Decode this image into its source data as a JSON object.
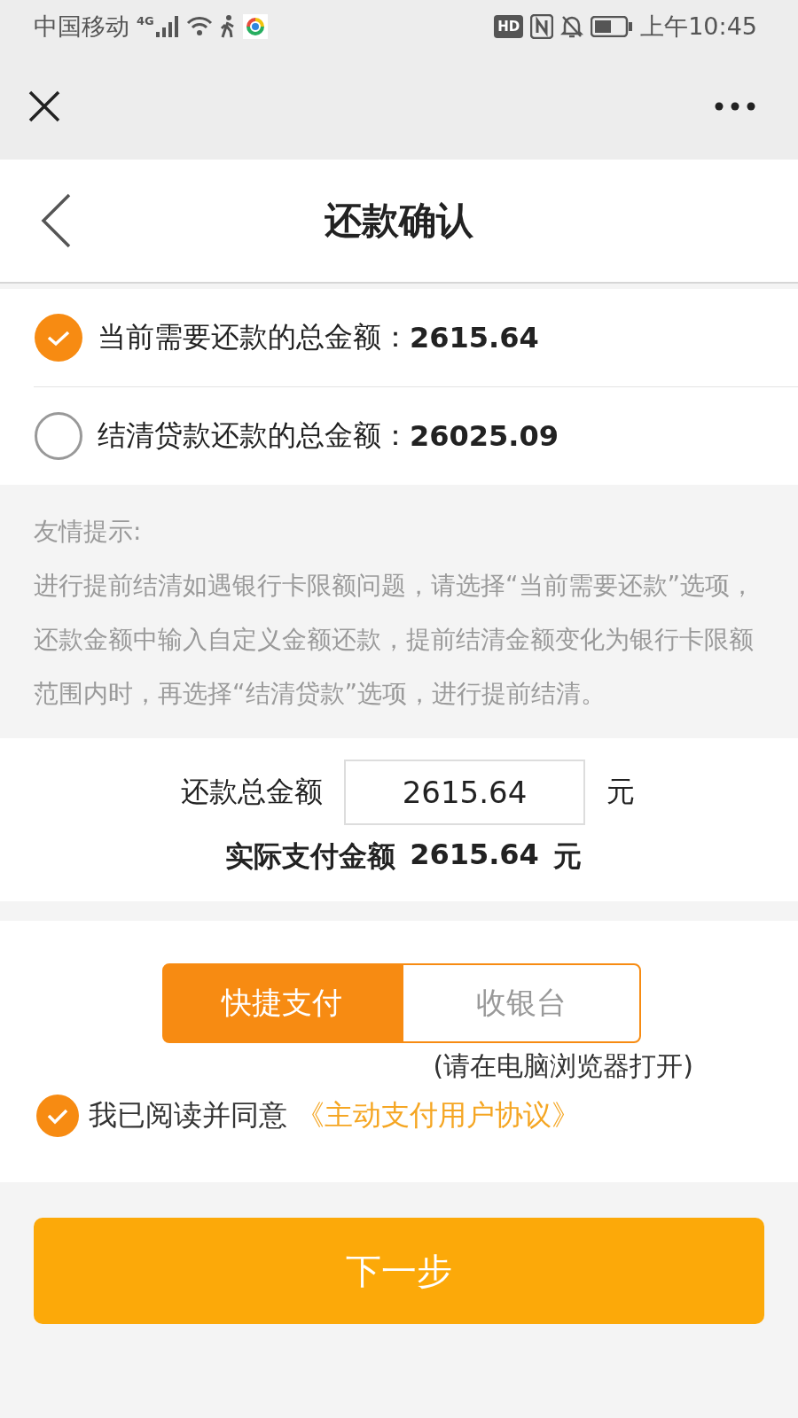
{
  "status_bar": {
    "carrier": "中国移动",
    "network": "4G",
    "hd": "HD",
    "time": "上午10:45"
  },
  "page": {
    "title": "还款确认"
  },
  "options": [
    {
      "label": "当前需要还款的总金额：",
      "amount": "2615.64",
      "selected": true
    },
    {
      "label": "结清贷款还款的总金额：",
      "amount": "26025.09",
      "selected": false
    }
  ],
  "tip": {
    "title": "友情提示:",
    "text": "进行提前结清如遇银行卡限额问题，请选择“当前需要还款”选项，还款金额中输入自定义金额还款，提前结清金额变化为银行卡限额范围内时，再选择“结清贷款”选项，进行提前结清。"
  },
  "amount": {
    "label": "还款总金额",
    "value": "2615.64",
    "unit": "元",
    "actual_label": "实际支付金额",
    "actual_value": "2615.64",
    "actual_unit": "元"
  },
  "pay_tabs": [
    {
      "label": "快捷支付",
      "selected": true
    },
    {
      "label": "收银台",
      "selected": false
    }
  ],
  "pay_note": "(请在电脑浏览器打开)",
  "agreement": {
    "checked": true,
    "text": "我已阅读并同意",
    "link": "《主动支付用户协议》"
  },
  "next_button": "下一步"
}
